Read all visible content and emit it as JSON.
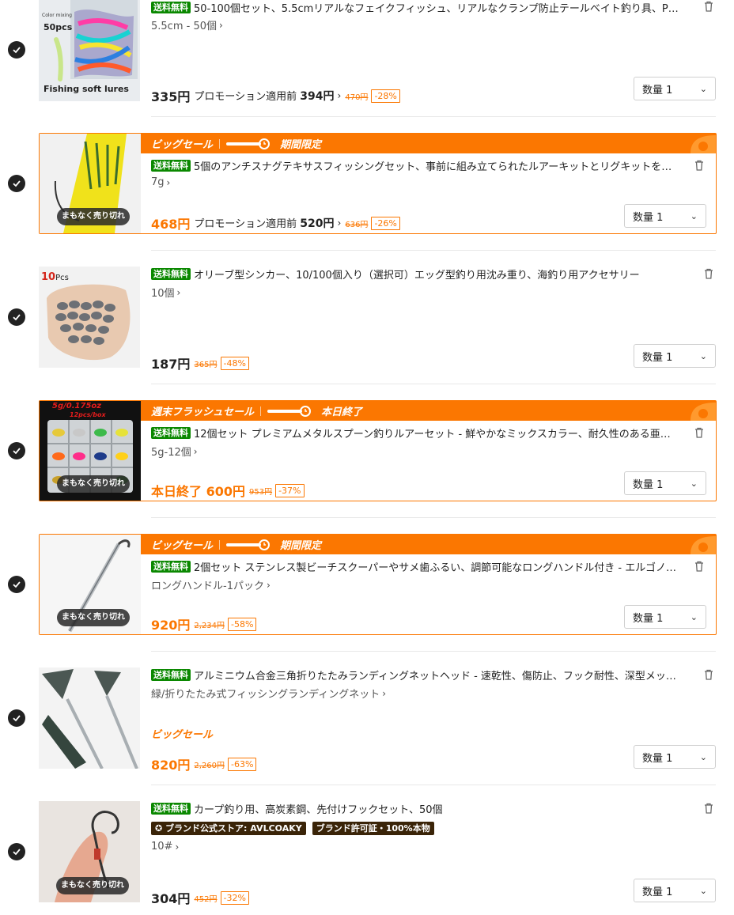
{
  "common": {
    "free_shipping": "送料無料",
    "qty_label": "数量 1",
    "selling_out": "まもなく売り切れ",
    "promo_prefix": "プロモーション適用前"
  },
  "items": [
    {
      "title": "50-100個セット、5.5cmリアルなフェイクフィッシュ、リアルなクランプ防止テールベイト釣り具、PVC製の海と淡水...",
      "variant": "5.5cm - 50個",
      "price": "335円",
      "promo_price": "394円",
      "original_price": "470円",
      "discount": "-28%",
      "thumb_text_top": "Color mixing",
      "thumb_text_count": "50pcs",
      "thumb_text_bottom": "Fishing soft lures"
    },
    {
      "banner_label": "ビッグセール",
      "banner_tag": "期間限定",
      "title": "5個のアンチスナグテキサスフィッシングセット、事前に組み立てられたルアーキットとリグキットを含み、バスとトラウト...",
      "variant": "7g",
      "price": "468円",
      "promo_price": "520円",
      "original_price": "636円",
      "discount": "-26%"
    },
    {
      "title": "オリーブ型シンカー、10/100個入り（選択可）エッグ型釣り用沈み重り、海釣り用アクセサリー",
      "variant": "10個",
      "price": "187円",
      "original_price": "365円",
      "discount": "-48%",
      "thumb_text_top": "10",
      "thumb_text_top2": "Pcs"
    },
    {
      "banner_label": "週末フラッシュセール",
      "banner_tag": "本日終了",
      "title": "12個セット プレミアムメタルスプーン釣りルアーセット - 鮮やかなミックスカラー、耐久性のある亜鉛合金、トラウト...",
      "variant": "5g-12個",
      "price": "本日終了 600円",
      "original_price": "953円",
      "discount": "-37%",
      "thumb_text_top": "5g/0.175oz",
      "thumb_text_sub": "12pcs/box"
    },
    {
      "banner_label": "ビッグセール",
      "banner_tag": "期間限定",
      "title": "2個セット ステンレス製ビーチスクーパーやサメ歯ふるい、調節可能なロングハンドル付き - エルゴノミックグリップ, ...",
      "variant": "ロングハンドル-1パック",
      "price": "920円",
      "original_price": "2,234円",
      "discount": "-58%"
    },
    {
      "title": "アルミニウム合金三角折りたたみランディングネットヘッド - 速乾性、傷防止、フック耐性、深型メッシュポーチ、大...",
      "variant": "緑/折りたたみ式フィッシングランディングネット",
      "big_sale": "ビッグセール",
      "price": "820円",
      "original_price": "2,260円",
      "discount": "-63%"
    },
    {
      "title": "カープ釣り用、高炭素鋼、先付けフックセット、50個",
      "badge_store": "ブランド公式ストア: AVLCOAKY",
      "badge_auth": "ブランド許可証・100%本物",
      "variant": "10#",
      "price": "304円",
      "original_price": "452円",
      "discount": "-32%"
    }
  ],
  "colors": {
    "accent": "#fb7701",
    "free_shipping_bg": "#0a8800",
    "brand_badge_bg": "#3a2408"
  }
}
